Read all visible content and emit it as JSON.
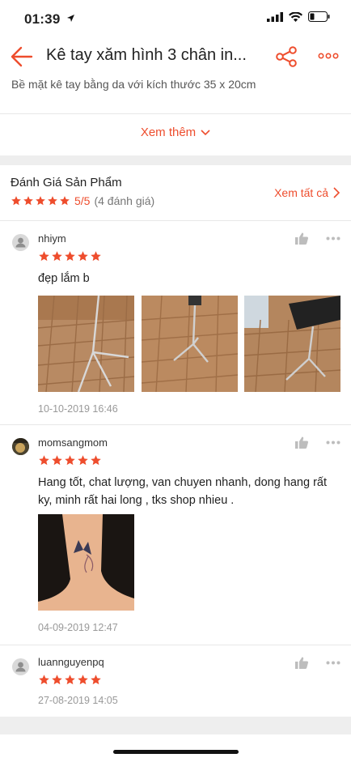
{
  "status_bar": {
    "time": "01:39"
  },
  "header": {
    "title": "Kê tay xăm hình 3 chân in..."
  },
  "description": "Bề mặt kê tay bằng da với kích thước 35 x 20cm",
  "see_more": "Xem thêm",
  "ratings": {
    "title": "Đánh Giá Sản Phẩm",
    "score": "5/5",
    "count": "(4 đánh giá)",
    "see_all": "Xem tất cả",
    "stars": 5
  },
  "reviews": [
    {
      "username": "nhiym",
      "stars": 5,
      "text": "đẹp lắm b",
      "date": "10-10-2019 16:46",
      "photos": 3
    },
    {
      "username": "momsangmom",
      "stars": 5,
      "text": "Hang tốt, chat lượng, van chuyen nhanh, dong hang rất ky, minh rất hai long , tks shop nhieu .",
      "date": "04-09-2019 12:47",
      "photos": 1
    },
    {
      "username": "luannguyenpq",
      "stars": 5,
      "text": "",
      "date": "27-08-2019 14:05",
      "photos": 0
    }
  ],
  "colors": {
    "accent": "#ee4d2d",
    "star": "#ee4d2d",
    "divider": "#eeeeee"
  }
}
